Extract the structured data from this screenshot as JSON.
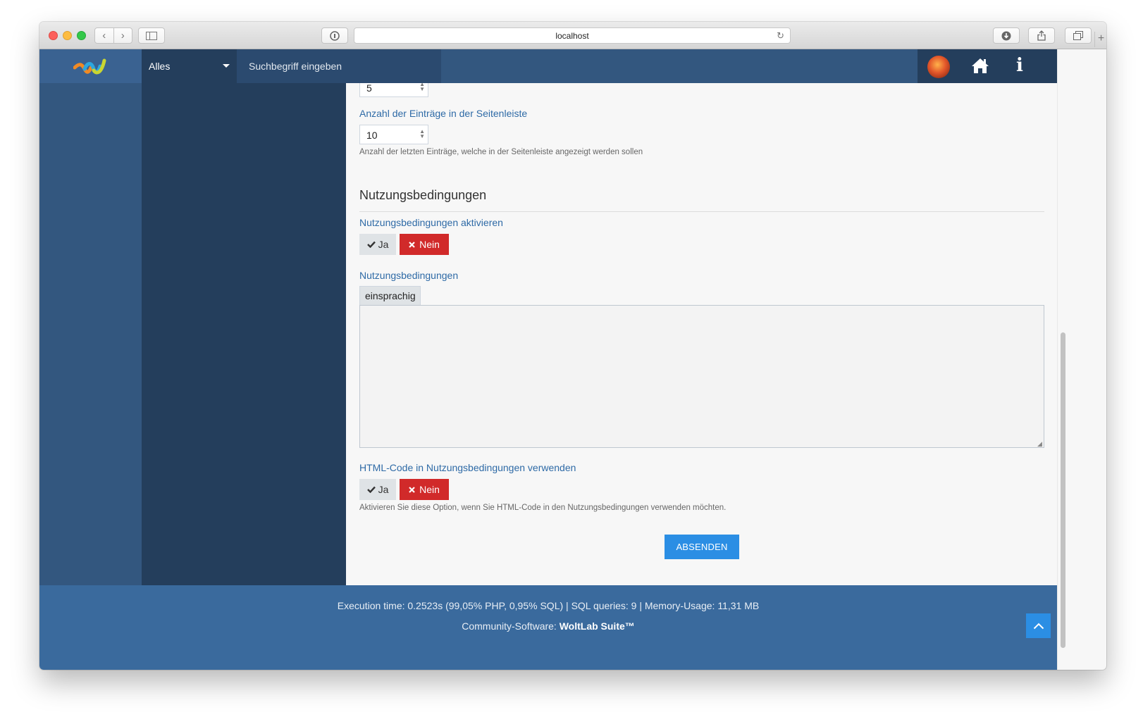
{
  "browser": {
    "url": "localhost"
  },
  "header": {
    "search_type": "Alles",
    "search_placeholder": "Suchbegriff eingeben"
  },
  "form": {
    "truncated_value": "5",
    "sidebar_entries": {
      "label": "Anzahl der Einträge in der Seitenleiste",
      "value": "10",
      "help": "Anzahl der letzten Einträge, welche in der Seitenleiste angezeigt werden sollen"
    },
    "section_title": "Nutzungsbedingungen",
    "enable_terms": {
      "label": "Nutzungsbedingungen aktivieren",
      "yes": "Ja",
      "no": "Nein"
    },
    "terms_text": {
      "label": "Nutzungsbedingungen",
      "language_tab": "einsprachig"
    },
    "html_terms": {
      "label": "HTML-Code in Nutzungsbedingungen verwenden",
      "yes": "Ja",
      "no": "Nein",
      "help": "Aktivieren Sie diese Option, wenn Sie HTML-Code in den Nutzungsbedingungen verwenden möchten."
    },
    "submit_label": "ABSENDEN"
  },
  "footer": {
    "stats": "Execution time: 0.2523s (99,05% PHP, 0,95% SQL) | SQL queries: 9 | Memory-Usage: 11,31 MB",
    "software_prefix": "Community-Software: ",
    "software_name": "WoltLab Suite™"
  },
  "colors": {
    "header": "#33577f",
    "sidebar_dark": "#243e5c",
    "accent": "#2b8ee4",
    "danger": "#d12a2a",
    "label": "#2e6aa6",
    "footer": "#3a6a9d"
  },
  "icons": [
    "back-icon",
    "forward-icon",
    "sidebar-toggle-icon",
    "privacy-icon",
    "reload-icon",
    "download-icon",
    "share-icon",
    "tabs-icon",
    "caret-down-icon",
    "home-icon",
    "info-icon",
    "check-icon",
    "times-icon",
    "resize-icon",
    "chevron-up-icon"
  ]
}
